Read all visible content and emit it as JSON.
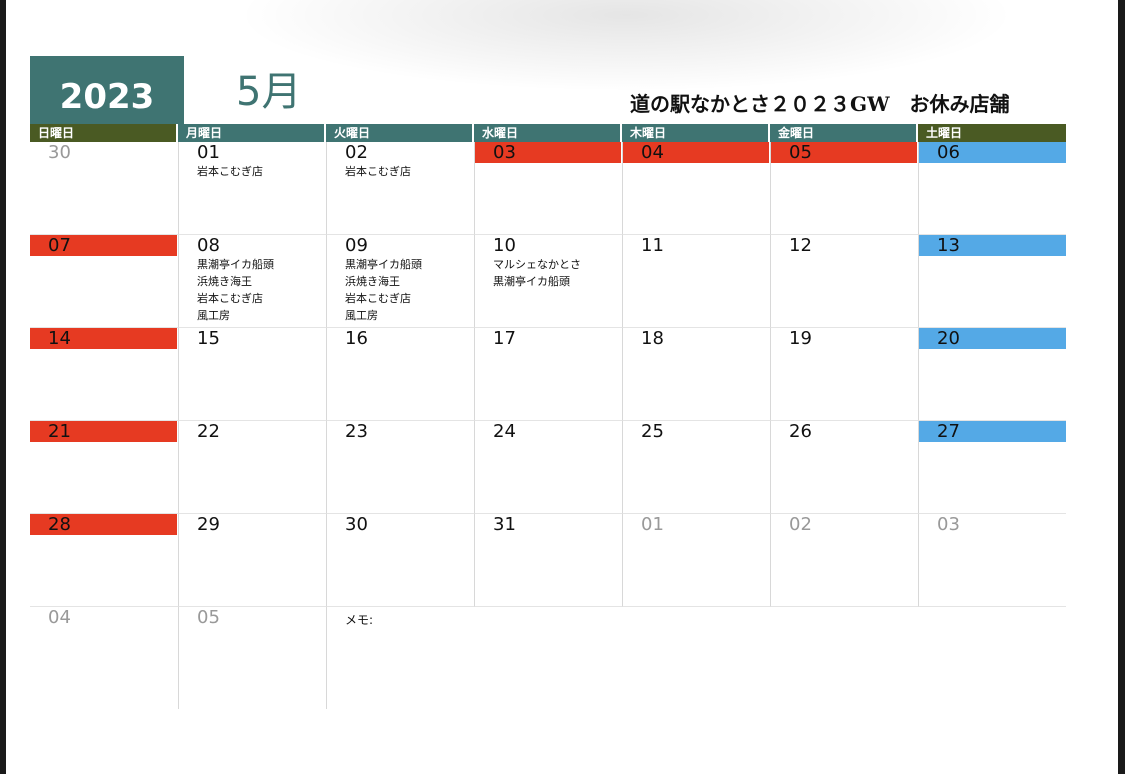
{
  "header": {
    "year": "2023",
    "month": "5月",
    "title": "道の駅なかとさ２０２３GW　お休み店舗"
  },
  "weekdays": [
    {
      "label": "日曜日",
      "kind": "we"
    },
    {
      "label": "月曜日",
      "kind": "wk"
    },
    {
      "label": "火曜日",
      "kind": "wk"
    },
    {
      "label": "水曜日",
      "kind": "wk"
    },
    {
      "label": "木曜日",
      "kind": "wk"
    },
    {
      "label": "金曜日",
      "kind": "wk"
    },
    {
      "label": "土曜日",
      "kind": "we"
    }
  ],
  "weeks": [
    [
      {
        "num": "30",
        "style": "other",
        "shops": []
      },
      {
        "num": "01",
        "style": "",
        "shops": [
          "岩本こむぎ店"
        ]
      },
      {
        "num": "02",
        "style": "",
        "shops": [
          "岩本こむぎ店"
        ]
      },
      {
        "num": "03",
        "style": "red",
        "shops": []
      },
      {
        "num": "04",
        "style": "red",
        "shops": []
      },
      {
        "num": "05",
        "style": "red",
        "shops": []
      },
      {
        "num": "06",
        "style": "blue",
        "shops": []
      }
    ],
    [
      {
        "num": "07",
        "style": "red",
        "shops": []
      },
      {
        "num": "08",
        "style": "",
        "shops": [
          "黒潮亭イカ船頭",
          "浜焼き海王",
          "岩本こむぎ店",
          "風工房"
        ]
      },
      {
        "num": "09",
        "style": "",
        "shops": [
          "黒潮亭イカ船頭",
          "浜焼き海王",
          "岩本こむぎ店",
          "風工房"
        ]
      },
      {
        "num": "10",
        "style": "",
        "shops": [
          "マルシェなかとさ",
          "黒潮亭イカ船頭"
        ]
      },
      {
        "num": "11",
        "style": "",
        "shops": []
      },
      {
        "num": "12",
        "style": "",
        "shops": []
      },
      {
        "num": "13",
        "style": "blue",
        "shops": []
      }
    ],
    [
      {
        "num": "14",
        "style": "red",
        "shops": []
      },
      {
        "num": "15",
        "style": "",
        "shops": []
      },
      {
        "num": "16",
        "style": "",
        "shops": []
      },
      {
        "num": "17",
        "style": "",
        "shops": []
      },
      {
        "num": "18",
        "style": "",
        "shops": []
      },
      {
        "num": "19",
        "style": "",
        "shops": []
      },
      {
        "num": "20",
        "style": "blue",
        "shops": []
      }
    ],
    [
      {
        "num": "21",
        "style": "red",
        "shops": []
      },
      {
        "num": "22",
        "style": "",
        "shops": []
      },
      {
        "num": "23",
        "style": "",
        "shops": []
      },
      {
        "num": "24",
        "style": "",
        "shops": []
      },
      {
        "num": "25",
        "style": "",
        "shops": []
      },
      {
        "num": "26",
        "style": "",
        "shops": []
      },
      {
        "num": "27",
        "style": "blue",
        "shops": []
      }
    ],
    [
      {
        "num": "28",
        "style": "red",
        "shops": []
      },
      {
        "num": "29",
        "style": "",
        "shops": []
      },
      {
        "num": "30",
        "style": "",
        "shops": []
      },
      {
        "num": "31",
        "style": "",
        "shops": []
      },
      {
        "num": "01",
        "style": "other",
        "shops": []
      },
      {
        "num": "02",
        "style": "other",
        "shops": []
      },
      {
        "num": "03",
        "style": "other",
        "shops": []
      }
    ]
  ],
  "last_row": [
    {
      "num": "04",
      "style": "other"
    },
    {
      "num": "05",
      "style": "other"
    }
  ],
  "memo_label": "メモ:",
  "colors": {
    "header_teal": "#3f7472",
    "weekend_header": "#4a5a23",
    "holiday_red": "#e63a22",
    "saturday_blue": "#54a9e6"
  }
}
